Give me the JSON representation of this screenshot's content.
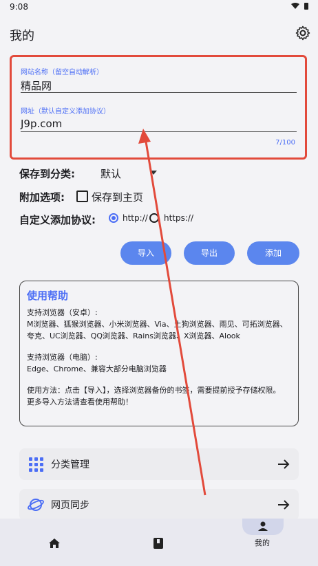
{
  "status_bar": {
    "time": "9:08",
    "icons": "▾ ▮"
  },
  "header": {
    "title": "我的"
  },
  "form": {
    "site_name_label": "网站名称（留空自动解析）",
    "site_name_value": "精品网",
    "url_label": "网址（默认自定义添加协议）",
    "url_value": "J9p.com",
    "counter": "7/100"
  },
  "save_category": {
    "label": "保存到分类:",
    "value": "默认"
  },
  "options": {
    "label": "附加选项:",
    "save_to_home": "保存到主页"
  },
  "protocol": {
    "label": "自定义添加协议:",
    "http": "http://",
    "https": "https://"
  },
  "buttons": {
    "import": "导入",
    "export": "导出",
    "add": "添加"
  },
  "help": {
    "title": "使用帮助",
    "android_title": "支持浏览器（安卓）:",
    "android_list": "M浏览器、狐猴浏览器、小米浏览器、Via、土狗浏览器、雨见、可拓浏览器、夸克、UC浏览器、QQ浏览器、Rains浏览器、X浏览器、Alook",
    "pc_title": "支持浏览器（电脑）:",
    "pc_list": "Edge、Chrome、兼容大部分电脑浏览器",
    "usage": "使用方法：点击【导入】，选择浏览器备份的书签，需要提前授予存储权限。",
    "more": "更多导入方法请查看使用帮助！"
  },
  "menu": [
    {
      "label": "分类管理"
    },
    {
      "label": "网页同步"
    }
  ],
  "bottom_nav": {
    "mine_label": "我的"
  },
  "colors": {
    "accent": "#5b86ee",
    "annotation": "#e24a3b"
  }
}
